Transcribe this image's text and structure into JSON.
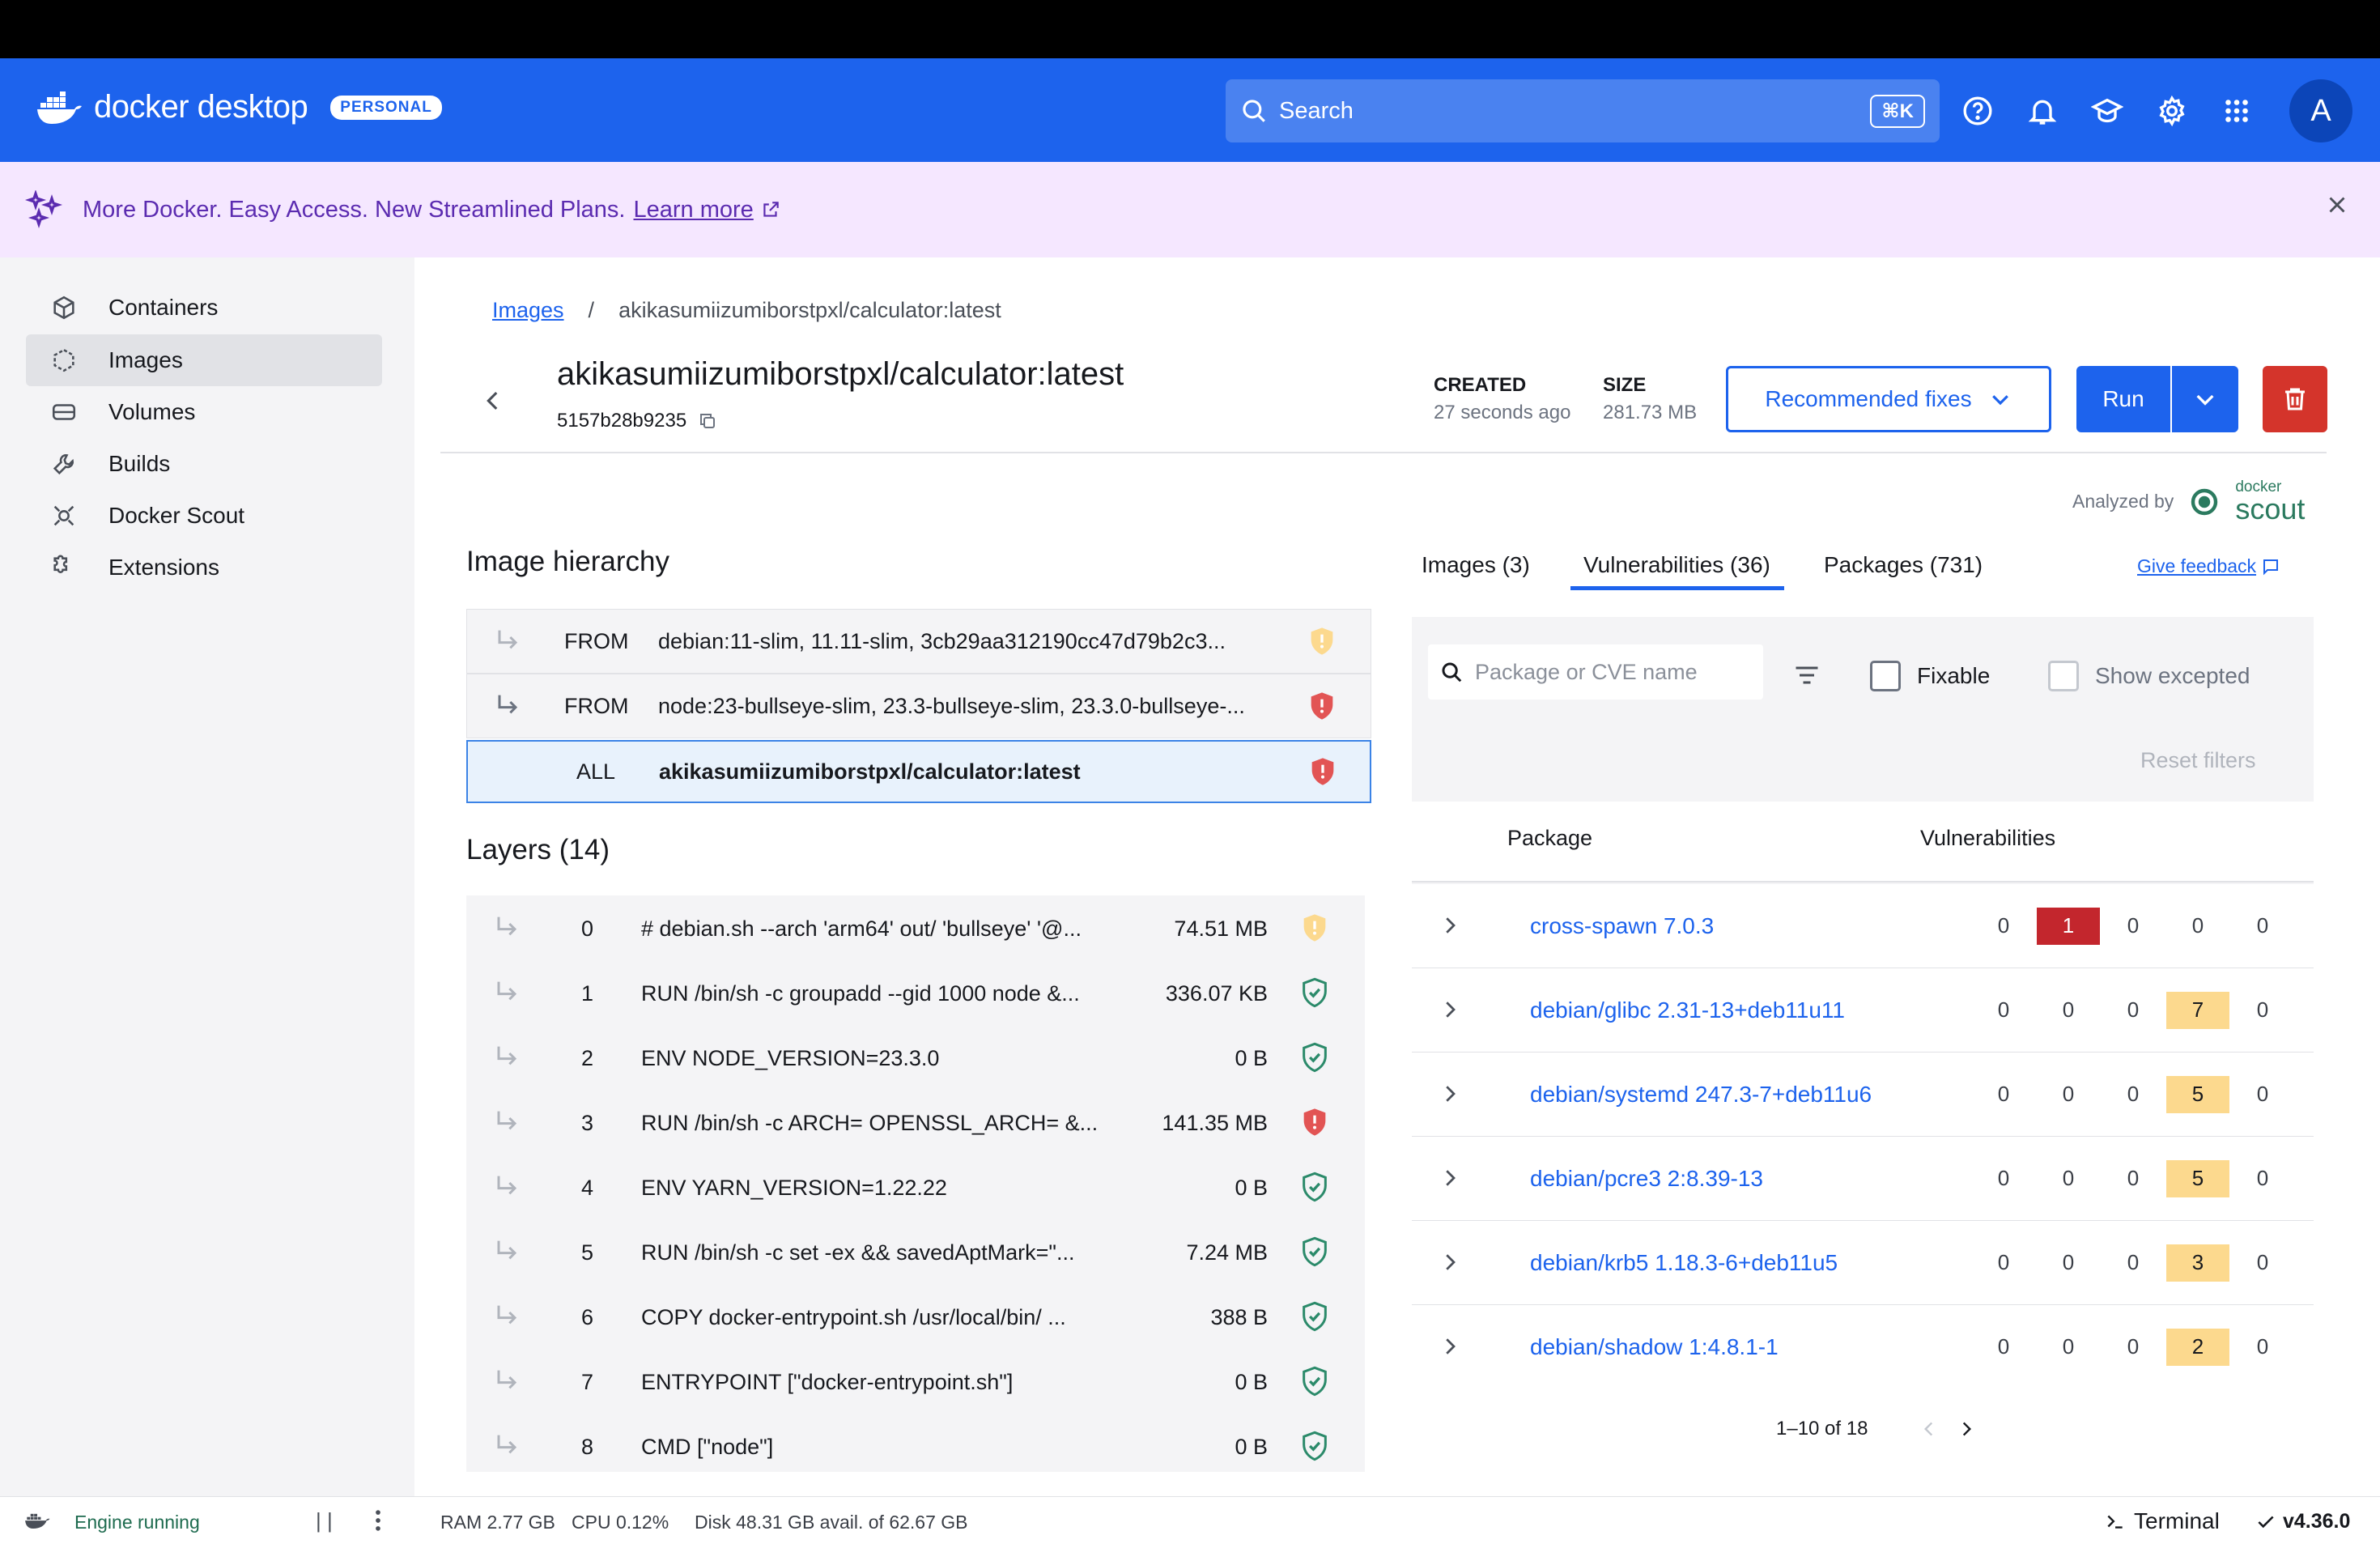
{
  "app": {
    "logo_text": "docker desktop",
    "plan_badge": "PERSONAL",
    "search_placeholder": "Search",
    "search_shortcut": "⌘K",
    "avatar_letter": "A"
  },
  "promo": {
    "text": "More Docker. Easy Access. New Streamlined Plans.",
    "link": "Learn more"
  },
  "sidebar": {
    "items": [
      {
        "label": "Containers",
        "icon": "container-icon"
      },
      {
        "label": "Images",
        "icon": "images-icon",
        "selected": true
      },
      {
        "label": "Volumes",
        "icon": "volumes-icon"
      },
      {
        "label": "Builds",
        "icon": "builds-icon"
      },
      {
        "label": "Docker Scout",
        "icon": "scout-icon"
      },
      {
        "label": "Extensions",
        "icon": "extensions-icon"
      }
    ]
  },
  "breadcrumb": {
    "root": "Images",
    "separator": "/",
    "current": "akikasumiizumiborstpxl/calculator:latest"
  },
  "image": {
    "name": "akikasumiizumiborstpxl/calculator:latest",
    "id": "5157b28b9235",
    "created_label": "CREATED",
    "created_value": "27 seconds ago",
    "size_label": "SIZE",
    "size_value": "281.73 MB"
  },
  "actions": {
    "recommended_fixes": "Recommended fixes",
    "run": "Run"
  },
  "analyzed": {
    "label": "Analyzed by",
    "brand_small": "docker",
    "brand_large": "scout"
  },
  "hierarchy": {
    "title": "Image hierarchy",
    "rows": [
      {
        "kind": "FROM",
        "text": "debian:11-slim, 11.11-slim, 3cb29aa312190cc47d79b2c3...",
        "status": "warning"
      },
      {
        "kind": "FROM",
        "text": "node:23-bullseye-slim, 23.3-bullseye-slim, 23.3.0-bullseye-...",
        "status": "critical"
      },
      {
        "kind": "ALL",
        "text": "akikasumiizumiborstpxl/calculator:latest",
        "status": "critical",
        "selected": true
      }
    ]
  },
  "layers": {
    "title": "Layers (14)",
    "rows": [
      {
        "index": "0",
        "command": "# debian.sh --arch 'arm64' out/ 'bullseye' '@...",
        "size": "74.51 MB",
        "status": "warning"
      },
      {
        "index": "1",
        "command": "RUN /bin/sh -c groupadd --gid 1000 node &...",
        "size": "336.07 KB",
        "status": "ok"
      },
      {
        "index": "2",
        "command": "ENV NODE_VERSION=23.3.0",
        "size": "0 B",
        "status": "ok"
      },
      {
        "index": "3",
        "command": "RUN /bin/sh -c ARCH= OPENSSL_ARCH= &...",
        "size": "141.35 MB",
        "status": "critical"
      },
      {
        "index": "4",
        "command": "ENV YARN_VERSION=1.22.22",
        "size": "0 B",
        "status": "ok"
      },
      {
        "index": "5",
        "command": "RUN /bin/sh -c set -ex && savedAptMark=\"...",
        "size": "7.24 MB",
        "status": "ok"
      },
      {
        "index": "6",
        "command": "COPY docker-entrypoint.sh /usr/local/bin/ ...",
        "size": "388 B",
        "status": "ok"
      },
      {
        "index": "7",
        "command": "ENTRYPOINT [\"docker-entrypoint.sh\"]",
        "size": "0 B",
        "status": "ok"
      },
      {
        "index": "8",
        "command": "CMD [\"node\"]",
        "size": "0 B",
        "status": "ok"
      }
    ]
  },
  "tabs": {
    "images": "Images (3)",
    "vulnerabilities": "Vulnerabilities (36)",
    "packages": "Packages (731)",
    "active": "vulnerabilities",
    "feedback": "Give feedback"
  },
  "filters": {
    "search_placeholder": "Package or CVE name",
    "fixable": "Fixable",
    "show_excepted": "Show excepted",
    "reset": "Reset filters"
  },
  "packages_table": {
    "col_package": "Package",
    "col_vulns": "Vulnerabilities",
    "severity_colors": {
      "critical": "#c3262d",
      "high": "#f5b1a0",
      "medium": "#fcd98e",
      "low": "#f4f4f6"
    },
    "rows": [
      {
        "name": "cross-spawn 7.0.3",
        "counts": [
          "0",
          "1",
          "0",
          "0",
          "0"
        ],
        "highlight": 1
      },
      {
        "name": "debian/glibc 2.31-13+deb11u11",
        "counts": [
          "0",
          "0",
          "0",
          "7",
          "0"
        ],
        "highlight": 3
      },
      {
        "name": "debian/systemd 247.3-7+deb11u6",
        "counts": [
          "0",
          "0",
          "0",
          "5",
          "0"
        ],
        "highlight": 3
      },
      {
        "name": "debian/pcre3 2:8.39-13",
        "counts": [
          "0",
          "0",
          "0",
          "5",
          "0"
        ],
        "highlight": 3
      },
      {
        "name": "debian/krb5 1.18.3-6+deb11u5",
        "counts": [
          "0",
          "0",
          "0",
          "3",
          "0"
        ],
        "highlight": 3
      },
      {
        "name": "debian/shadow 1:4.8.1-1",
        "counts": [
          "0",
          "0",
          "0",
          "2",
          "0"
        ],
        "highlight": 3
      }
    ],
    "pagination": "1–10 of 18"
  },
  "status": {
    "engine": "Engine running",
    "ram": "RAM 2.77 GB",
    "cpu": "CPU 0.12%",
    "disk": "Disk 48.31 GB avail. of 62.67 GB",
    "terminal": "Terminal",
    "version": "v4.36.0"
  }
}
